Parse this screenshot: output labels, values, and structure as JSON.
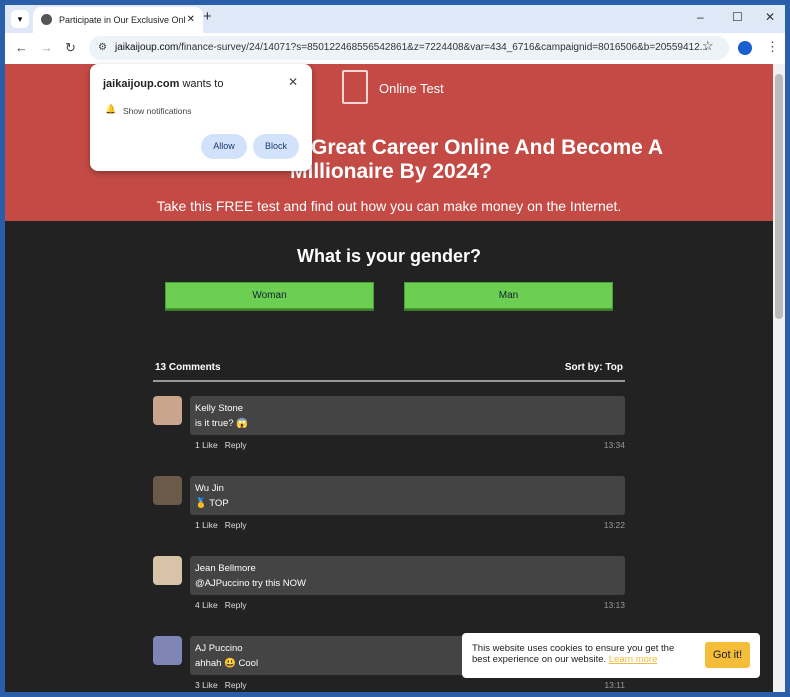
{
  "browser": {
    "tab_title": "Participate in Our Exclusive Onl",
    "url_domain": "jaikaijoup.com",
    "url_rest": "/finance-survey/24/14071?s=850122468556542861&z=7224408&var=434_6716&campaignid=8016506&b=20559412..."
  },
  "popup": {
    "site": "jaikaijoup.com",
    "wants": " wants to",
    "permission": "Show notifications",
    "allow": "Allow",
    "block": "Block"
  },
  "hero": {
    "logo_text": "Online Test",
    "headline_1": "Great Career Online And Become A",
    "headline_2": "Millionaire By 2024?",
    "subtitle": "Take this FREE test and find out how you can make money on the Internet."
  },
  "question": {
    "text": "What is your gender?",
    "options": [
      "Woman",
      "Man"
    ]
  },
  "comments": {
    "count": "13 Comments",
    "sort": "Sort by: Top",
    "items": [
      {
        "name": "Kelly Stone",
        "text": "is it true? 😱",
        "likes": "1 Like",
        "reply": "Reply",
        "time": "13:34"
      },
      {
        "name": "Wu Jin",
        "text": "🥇 TOP",
        "likes": "1 Like",
        "reply": "Reply",
        "time": "13:22"
      },
      {
        "name": "Jean Bellmore",
        "text": "@AJPuccino try this NOW",
        "likes": "4 Like",
        "reply": "Reply",
        "time": "13:13"
      },
      {
        "name": "AJ Puccino",
        "text": "ahhah 😃 Cool",
        "likes": "3 Like",
        "reply": "Reply",
        "time": "13:11"
      }
    ]
  },
  "cookie": {
    "text": "This website uses cookies to ensure you get the best experience on our website. ",
    "link": "Learn more",
    "button": "Got it!"
  },
  "colors": {
    "hero": "#c34a45",
    "button": "#6ccf52",
    "cookie_button": "#f4bd3a"
  }
}
